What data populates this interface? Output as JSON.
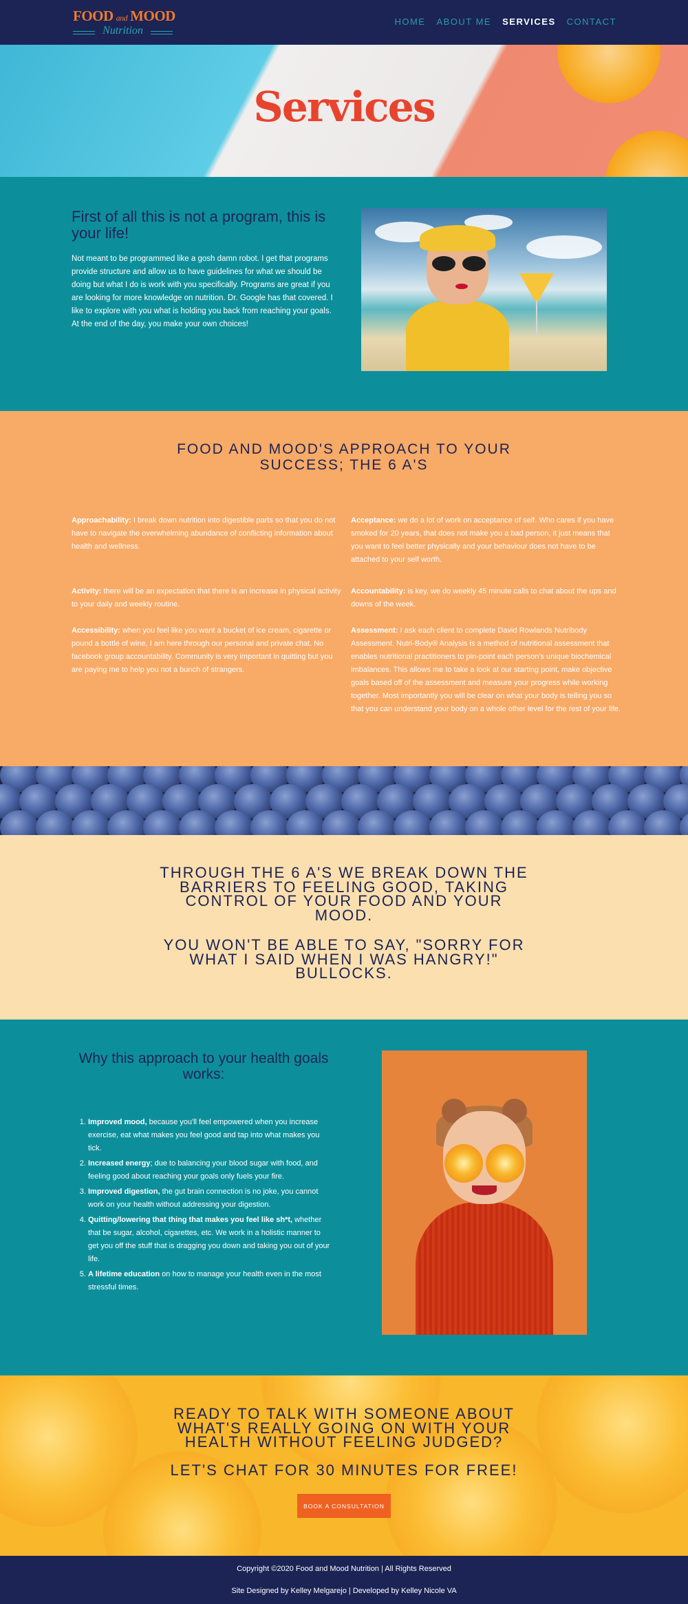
{
  "header": {
    "logo": {
      "line1": "FOOD",
      "and": "and",
      "line1b": "MOOD",
      "line2": "Nutrition"
    },
    "nav": [
      {
        "label": "HOME"
      },
      {
        "label": "ABOUT ME"
      },
      {
        "label": "SERVICES"
      },
      {
        "label": "CONTACT"
      }
    ]
  },
  "hero": {
    "title": "Services"
  },
  "intro": {
    "heading": "First of all this is not a program, this is your life!",
    "body": "Not meant to be programmed like a gosh damn robot. I get that programs provide structure and allow us to have guidelines for what we should be doing but what I do is work with you specifically. Programs are great if you are looking for more knowledge on nutrition. Dr. Google has that covered. I like to explore with you what is holding you back from reaching your goals. At the end of the day, you make your own choices!"
  },
  "approach": {
    "heading": "FOOD AND MOOD'S APPROACH TO YOUR SUCCESS; THE 6 A'S",
    "items": [
      {
        "term": "Approachability:",
        "text": " I break down nutrition into digestible parts so that you do not have to navigate the overwhelming abundance of conflicting information about health and wellness."
      },
      {
        "term": "Acceptance:",
        "text": " we do a lot of work on acceptance of self. Who cares if you have smoked for 20 years, that does not make you a bad person, it just means that you want to feel better physically and your behaviour does not have to be attached to your self worth."
      },
      {
        "term": "Activity:",
        "text": " there will be an expectation that there is an increase in physical activity to your daily and weekly routine."
      },
      {
        "term": "Accountability:",
        "text": " is key, we do weekly 45 minute calls to chat about the ups and downs of the week."
      },
      {
        "term": "Accessibility:",
        "text": " when you feel like you want a bucket of ice cream, cigarette or pound a bottle of wine, I am here through our personal and private chat. No facebook group accountability. Community is very important in quitting but you are paying me to help you not a bunch of strangers."
      },
      {
        "term": "Assessment:",
        "text": " I ask each client to complete David Rowlands Nutribody Assessment. Nutri-Body® Analysis is a method of nutritional assessment that enables nutritional practitioners to pin-point each person's unique biochemical imbalances. This allows me to take a look at our starting point, make objective goals based off of the assessment and measure your progress while working together. Most importantly you will be clear on what your body is telling you so that you can understand your body on a whole other level for the rest of your life."
      }
    ]
  },
  "statement": {
    "line1": "THROUGH THE 6 A'S WE BREAK DOWN THE BARRIERS TO FEELING GOOD, TAKING CONTROL OF YOUR FOOD AND YOUR MOOD.",
    "line2": "YOU WON'T BE ABLE TO SAY, \"SORRY FOR WHAT I SAID WHEN I WAS HANGRY!\" BULLOCKS."
  },
  "why": {
    "heading": "Why this approach to your health goals works:",
    "items": [
      {
        "term": "Improved mood,",
        "text": " because you'll feel empowered when you increase exercise, eat what makes you feel good and tap into what makes you tick."
      },
      {
        "term": "Increased energy",
        "text": "; due to balancing your blood sugar with food, and feeling good about reaching your goals only fuels your fire."
      },
      {
        "term": "Improved digestion,",
        "text": " the gut brain connection is no joke, you cannot work on your health without addressing your digestion."
      },
      {
        "term": "Quitting/lowering that thing that makes you feel like sh*t,",
        "text": " whether that be sugar, alcohol, cigarettes, etc. We work in a holistic manner to get you off the stuff that is dragging you down and taking you out of your life."
      },
      {
        "term": "A lifetime education",
        "text": " on how to manage your health even in the most stressful times."
      }
    ]
  },
  "cta": {
    "line1": "READY TO TALK WITH SOMEONE ABOUT WHAT'S REALLY GOING ON WITH YOUR HEALTH WITHOUT FEELING JUDGED?",
    "line2": "LET'S CHAT FOR 30 MINUTES FOR FREE!",
    "button": "BOOK A CONSULTATION"
  },
  "footer": {
    "copyright": "Copyright ©2020 Food and Mood Nutrition | All Rights Reserved",
    "credits": "Site Designed by Kelley Melgarejo | Developed by Kelley Nicole VA"
  }
}
